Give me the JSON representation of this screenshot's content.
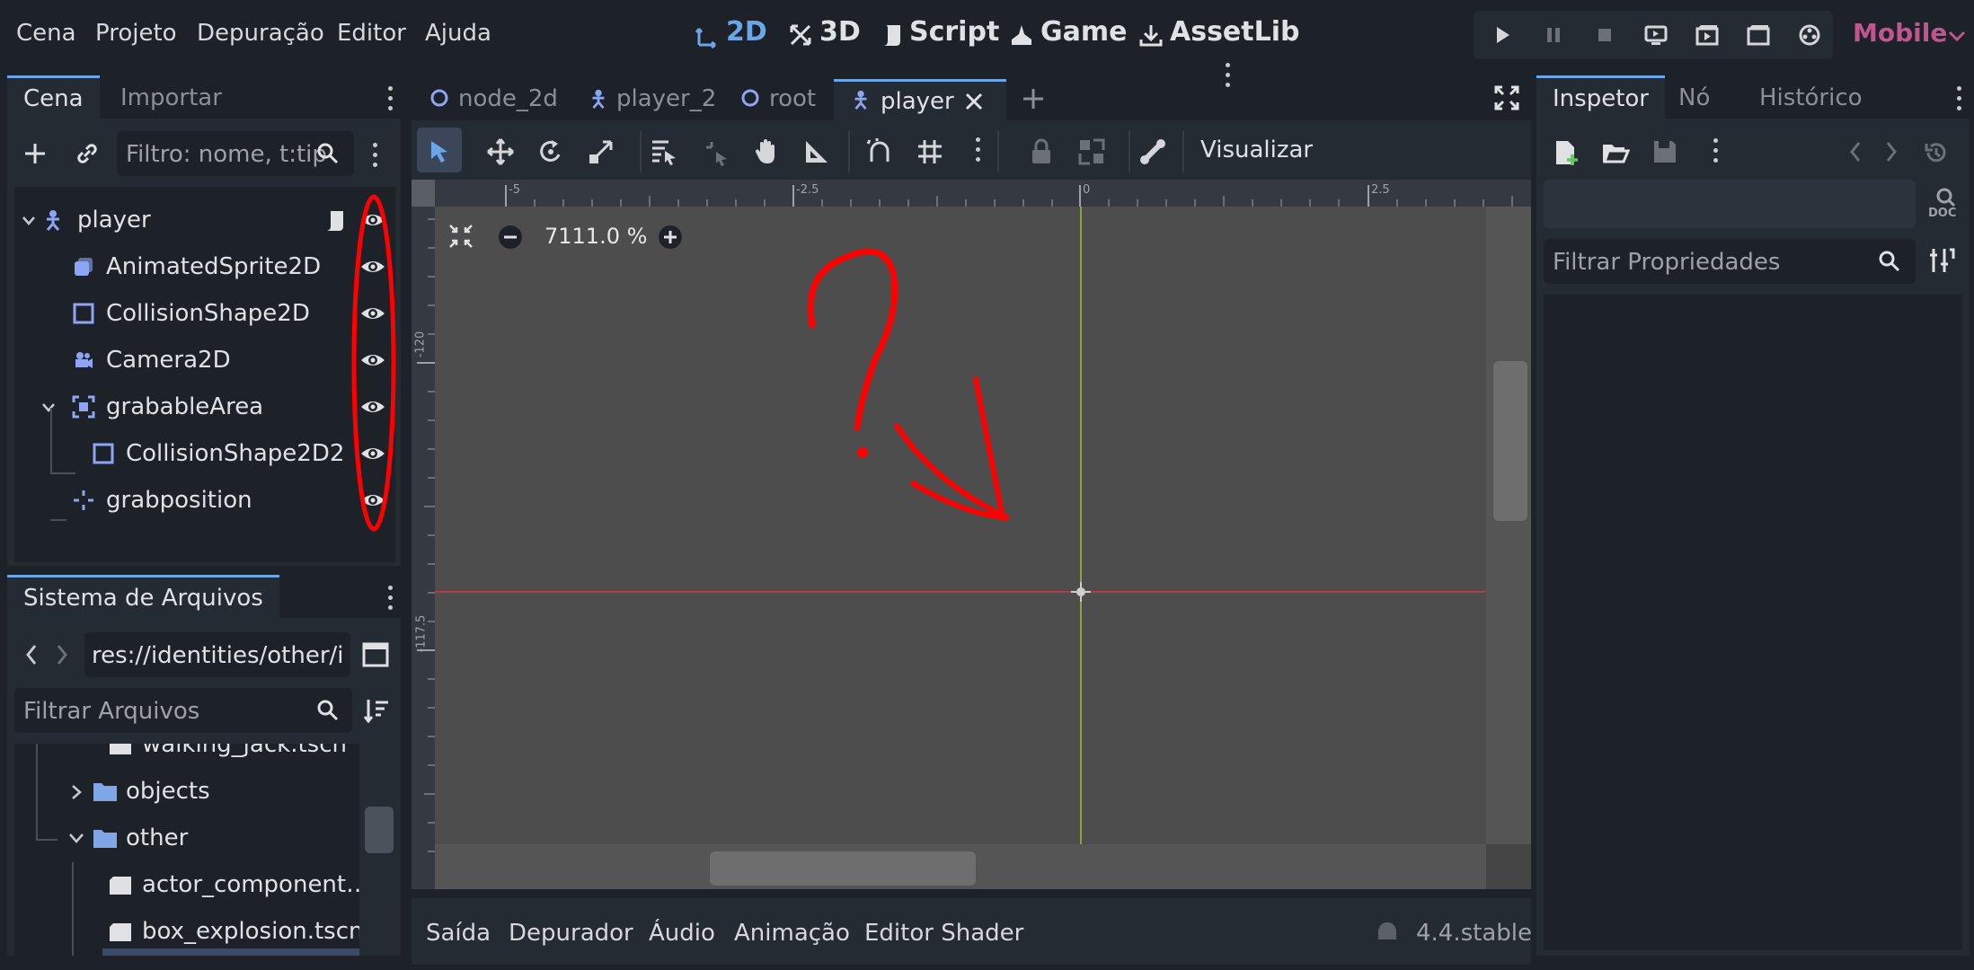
{
  "menu": [
    "Cena",
    "Projeto",
    "Depuração",
    "Editor",
    "Ajuda"
  ],
  "workspaces": {
    "w2d": "2D",
    "w3d": "3D",
    "script": "Script",
    "game": "Game",
    "assetlib": "AssetLib"
  },
  "renderer": "Mobile",
  "scene_dock": {
    "tabs": [
      "Cena",
      "Importar"
    ],
    "filter_placeholder": "Filtro: nome, t:tip",
    "nodes": [
      {
        "name": "player",
        "icon": "character-body-icon"
      },
      {
        "name": "AnimatedSprite2D",
        "icon": "animated-sprite-icon"
      },
      {
        "name": "CollisionShape2D",
        "icon": "collision-shape-icon"
      },
      {
        "name": "Camera2D",
        "icon": "camera-icon"
      },
      {
        "name": "grabableArea",
        "icon": "area-icon"
      },
      {
        "name": "CollisionShape2D2",
        "icon": "collision-shape-icon"
      },
      {
        "name": "grabposition",
        "icon": "marker-icon"
      }
    ]
  },
  "filesystem": {
    "title": "Sistema de Arquivos",
    "path": "res://identities/other/i",
    "filter_placeholder": "Filtrar Arquivos",
    "items": [
      {
        "name": "walking_jack.tscn",
        "type": "scene"
      },
      {
        "name": "objects",
        "type": "folder"
      },
      {
        "name": "other",
        "type": "folder"
      },
      {
        "name": "actor_component…",
        "type": "scene"
      },
      {
        "name": "box_explosion.tscn",
        "type": "scene"
      }
    ]
  },
  "editor": {
    "tabs": [
      "node_2d",
      "player_2",
      "root",
      "player"
    ],
    "view_menu": "Visualizar",
    "zoom": "7111.0 %",
    "ruler_h": [
      "-5",
      "-2.5",
      "0",
      "2.5"
    ],
    "ruler_v": [
      "-120",
      "-117.5"
    ]
  },
  "bottom_panel": {
    "tabs": [
      "Saída",
      "Depurador",
      "Áudio",
      "Animação",
      "Editor Shader"
    ],
    "version": "4.4.stable"
  },
  "inspector": {
    "tabs": [
      "Inspetor",
      "Nó",
      "Histórico"
    ],
    "filter_placeholder": "Filtrar Propriedades",
    "doc_label": "DOC"
  },
  "colors": {
    "accent": "#6aa6e8",
    "mobile": "#c0558f",
    "annotation": "#ff0000",
    "node_blue": "#8da5f3"
  }
}
